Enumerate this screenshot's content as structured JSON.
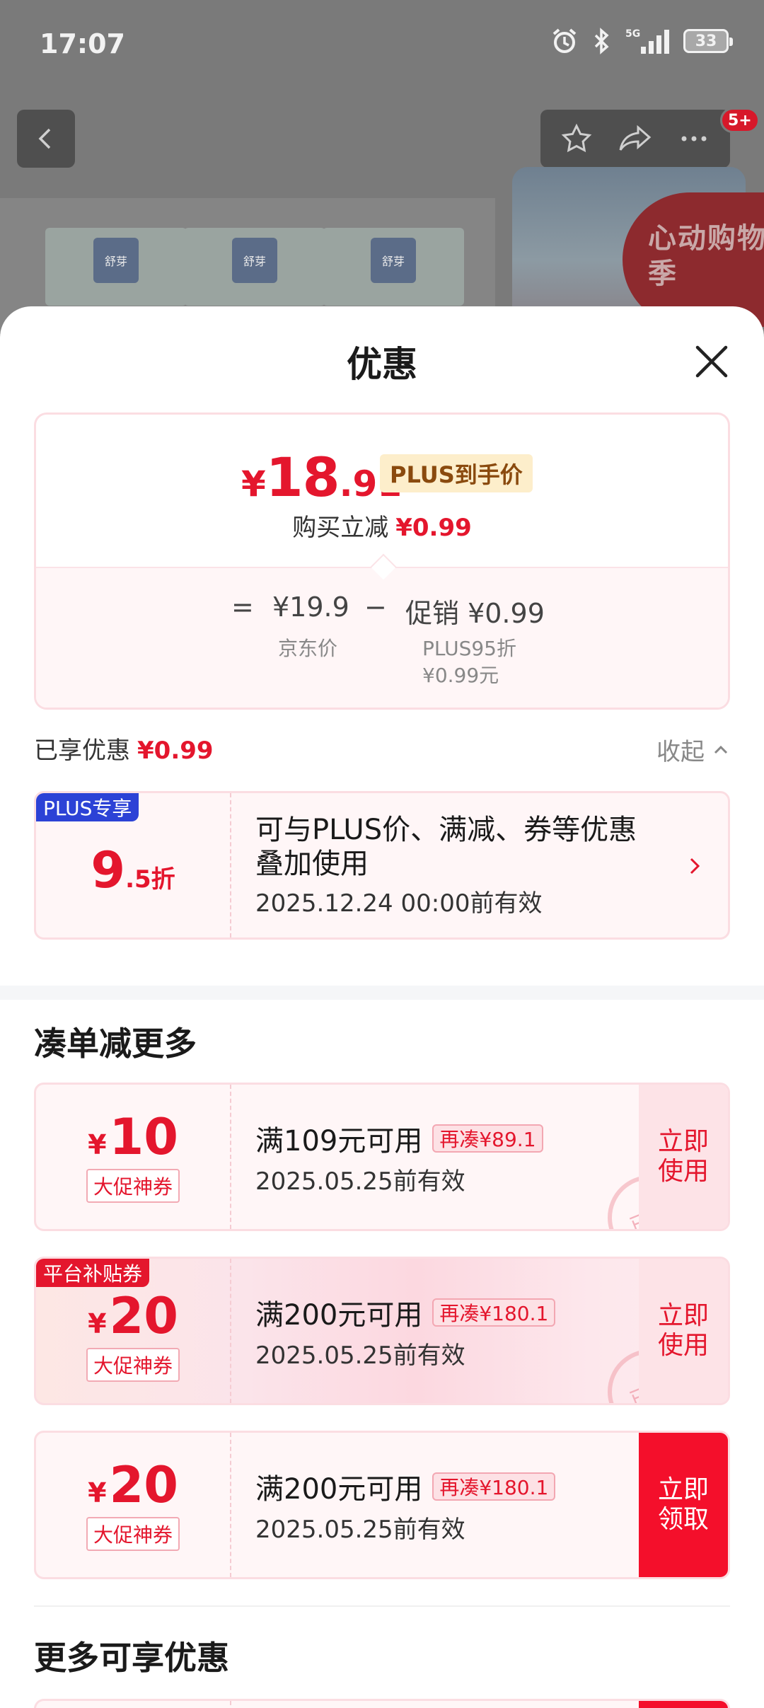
{
  "status_bar": {
    "time": "17:07",
    "battery": "33",
    "network": "5G"
  },
  "product_page": {
    "cart_badge": "5+",
    "brand_label": "舒芽",
    "promo_sticker": "心动购物季"
  },
  "sheet": {
    "title": "优惠",
    "price_card": {
      "yen": "¥",
      "price_int": "18",
      "price_dec": ".91",
      "plus_tag": "PLUS到手价",
      "reduce_label": "购买立减",
      "reduce_value": "¥0.99",
      "equals": "=",
      "jd_price": "¥19.9",
      "minus": "−",
      "promo_label": "促销 ¥0.99",
      "jd_price_caption": "京东价",
      "promo_caption_1": "PLUS95折",
      "promo_caption_2": "¥0.99元"
    },
    "enjoyed": {
      "label": "已享优惠",
      "value": "¥0.99",
      "collapse": "收起"
    },
    "plus_coupon": {
      "tag": "PLUS专享",
      "discount_int": "9",
      "discount_dec": ".5折",
      "desc_line1": "可与PLUS价、满减、券等优惠",
      "desc_line2": "叠加使用",
      "valid": "2025.12.24 00:00前有效"
    },
    "section_combine": "凑单减更多",
    "coupons": [
      {
        "tag": "",
        "yen": "¥",
        "amount": "10",
        "type": "大促神券",
        "condition": "满109元可用",
        "gap": "再凑¥89.1",
        "valid": "2025.05.25前有效",
        "action_line1": "立即",
        "action_line2": "使用",
        "stamp": "已领"
      },
      {
        "tag": "平台补贴券",
        "yen": "¥",
        "amount": "20",
        "type": "大促神券",
        "condition": "满200元可用",
        "gap": "再凑¥180.1",
        "valid": "2025.05.25前有效",
        "action_line1": "立即",
        "action_line2": "使用",
        "stamp": "已领"
      },
      {
        "tag": "",
        "yen": "¥",
        "amount": "20",
        "type": "大促神券",
        "condition": "满200元可用",
        "gap": "再凑¥180.1",
        "valid": "2025.05.25前有效",
        "action_line1": "立即",
        "action_line2": "领取",
        "stamp": ""
      }
    ],
    "section_more": "更多可享优惠"
  },
  "colors": {
    "accent_red": "#e4162d",
    "plus_blue": "#2c42d6",
    "plus_gold_bg": "#fdeecb"
  }
}
